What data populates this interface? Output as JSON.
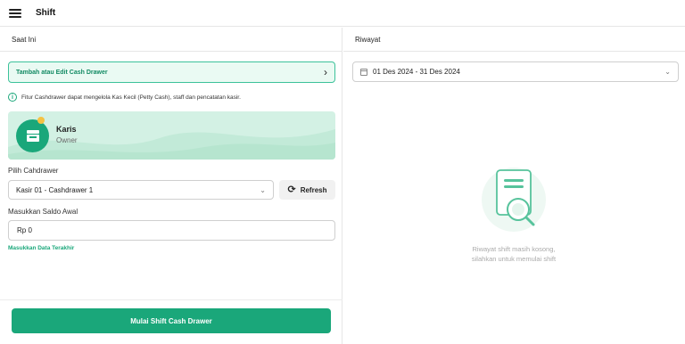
{
  "header": {
    "title": "Shift",
    "menu_icon": "hamburger-menu-icon"
  },
  "left_panel": {
    "title": "Saat Ini",
    "cash_drawer_link": {
      "label": "Tambah atau Edit Cash Drawer",
      "icon": "chevron-right-icon"
    },
    "info": {
      "icon": "info-icon",
      "text": "Fitur Cashdrawer dapat mengelola Kas Kecil (Petty Cash), staff dan pencatatan kasir."
    },
    "profile": {
      "name": "Karis",
      "role": "Owner",
      "avatar_icon": "store-avatar-icon"
    },
    "cashdrawer": {
      "label": "Pilih Cahdrawer",
      "selected": "Kasir 01 - Cashdrawer 1"
    },
    "refresh_button": {
      "label": "Refresh",
      "icon": "refresh-icon"
    },
    "saldo": {
      "label": "Masukkan Saldo Awal",
      "value": "Rp 0"
    },
    "last_data_link": "Masukkan Data Terakhir",
    "start_button": "Mulai Shift Cash Drawer"
  },
  "right_panel": {
    "title": "Riwayat",
    "date_range": "01 Des 2024 - 31 Des 2024",
    "empty_state": {
      "line1": "Riwayat shift masih kosong,",
      "line2": "silahkan untuk memulai shift",
      "icon": "document-search-icon"
    }
  },
  "colors": {
    "accent": "#1aa77a",
    "accent_light": "#d3f1e4",
    "link_bg": "#eafaf3"
  }
}
